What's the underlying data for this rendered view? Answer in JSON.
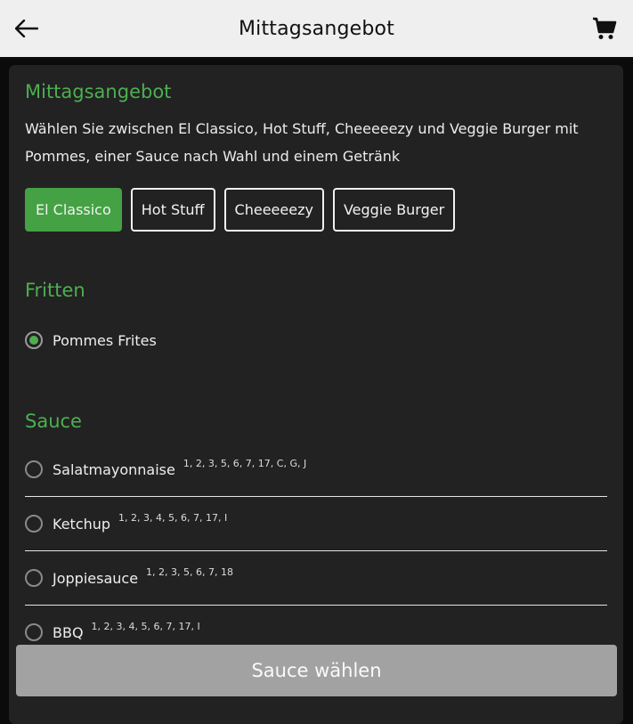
{
  "header": {
    "title": "Mittagsangebot",
    "back_icon": "arrow-left-icon",
    "cart_icon": "shopping-cart-icon"
  },
  "offer": {
    "title": "Mittagsangebot",
    "description": "Wählen Sie zwischen El Classico, Hot Stuff, Cheeeeezy und Veggie Burger mit Pommes, einer Sauce nach Wahl und einem Getränk",
    "burgers": [
      {
        "label": "El Classico",
        "selected": true
      },
      {
        "label": "Hot Stuff",
        "selected": false
      },
      {
        "label": "Cheeeeezy",
        "selected": false
      },
      {
        "label": "Veggie Burger",
        "selected": false
      }
    ]
  },
  "fritten": {
    "title": "Fritten",
    "options": [
      {
        "label": "Pommes Frites",
        "selected": true
      }
    ]
  },
  "sauce": {
    "title": "Sauce",
    "options": [
      {
        "label": "Salatmayonnaise",
        "allergens": "1, 2, 3, 5, 6, 7, 17, C, G, J",
        "selected": false
      },
      {
        "label": "Ketchup",
        "allergens": "1, 2, 3, 4, 5, 6, 7, 17, I",
        "selected": false
      },
      {
        "label": "Joppiesauce",
        "allergens": "1, 2, 3, 5, 6, 7, 18",
        "selected": false
      },
      {
        "label": "BBQ",
        "allergens": "1, 2, 3, 4, 5, 6, 7, 17, I",
        "selected": false
      }
    ]
  },
  "footer": {
    "button_label": "Sauce wählen"
  },
  "colors": {
    "accent": "#4caf50",
    "header_bg": "#efefef",
    "card_bg": "#222222",
    "button_disabled": "#a2a2a2"
  }
}
